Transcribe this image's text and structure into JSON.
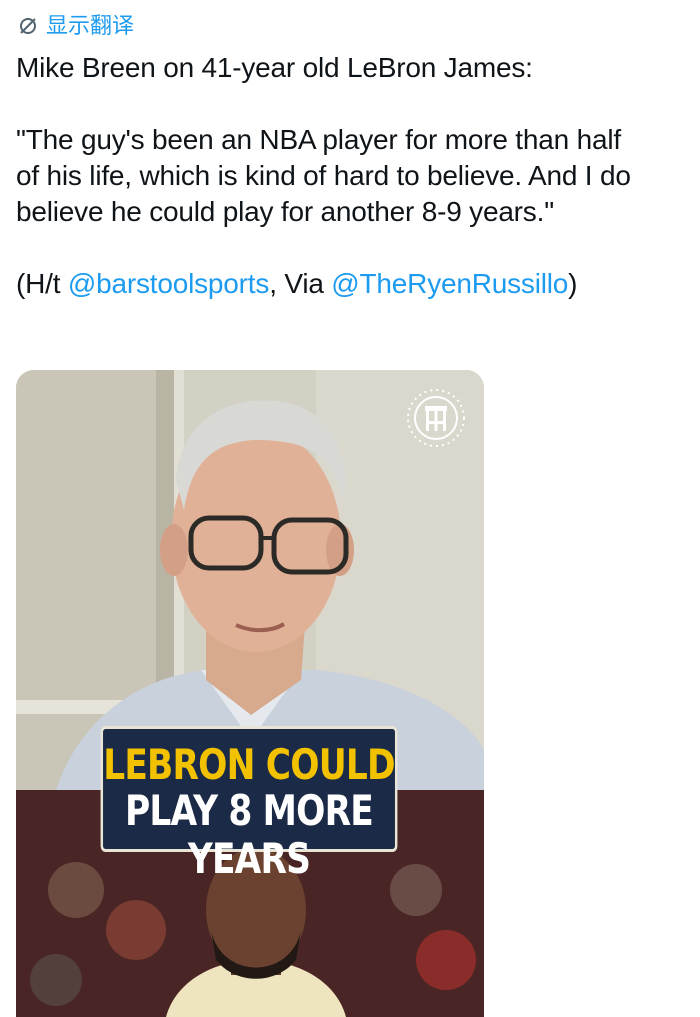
{
  "translate": {
    "label": "显示翻译",
    "icon": "globe-slash-icon"
  },
  "tweet": {
    "line1": "Mike Breen on 41-year old LeBron James:",
    "quote_line1": "\"The guy's been an NBA player for more than half",
    "quote_line2": "of his life, which is kind of hard to believe. And I do",
    "quote_line3": "believe he could play for another 8-9 years.\"",
    "credit_open": "(H/t ",
    "mention1": "@barstoolsports",
    "credit_mid": ", Via ",
    "mention2": "@TheRyenRussillo",
    "credit_close": ")"
  },
  "media": {
    "logo_icon": "barstool-logo-icon",
    "headline_line1": "LEBRON COULD",
    "headline_line2": "PLAY 8 MORE YEARS"
  },
  "colors": {
    "link": "#1d9bf0",
    "headline_yellow": "#f2c200",
    "headline_bg": "#1b2a46"
  }
}
